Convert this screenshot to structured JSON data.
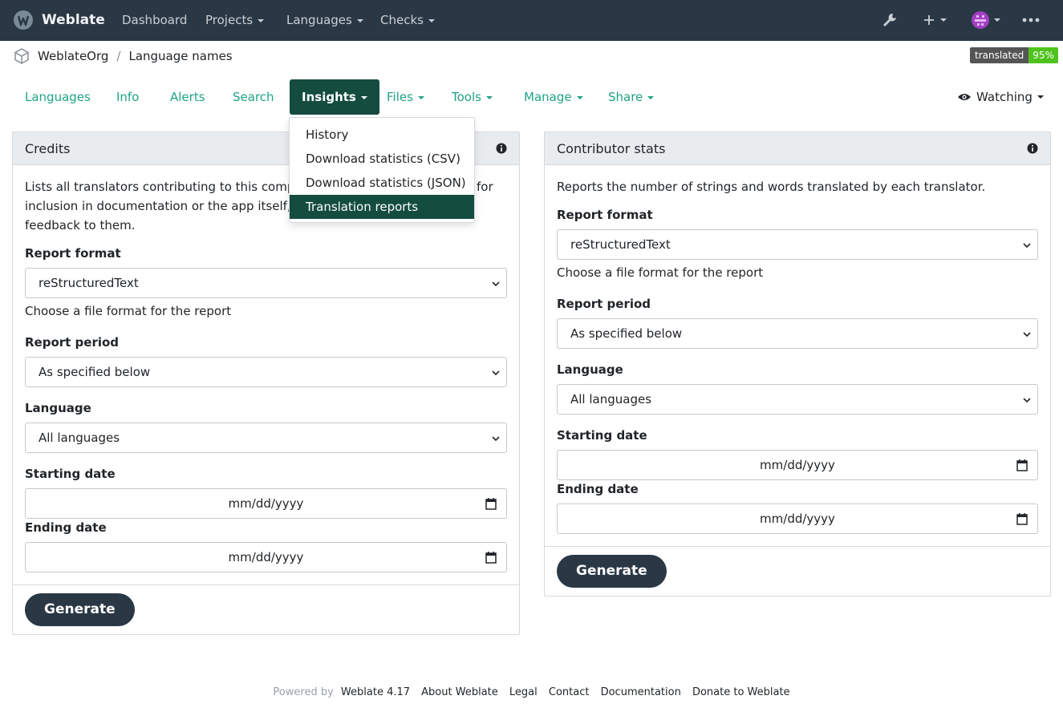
{
  "navbar": {
    "brand": "Weblate",
    "items": [
      {
        "label": "Dashboard",
        "dropdown": false
      },
      {
        "label": "Projects",
        "dropdown": true
      },
      {
        "label": "Languages",
        "dropdown": true
      },
      {
        "label": "Checks",
        "dropdown": true
      }
    ],
    "icons": [
      "wrench-icon",
      "plus-icon",
      "avatar",
      "more-icon"
    ]
  },
  "breadcrumb": {
    "project": "WeblateOrg",
    "component": "Language names"
  },
  "badge": {
    "label": "translated",
    "value": "95%"
  },
  "tabs": [
    {
      "label": "Languages"
    },
    {
      "label": "Info"
    },
    {
      "label": "Alerts"
    },
    {
      "label": "Search"
    },
    {
      "label": "Insights",
      "active": true
    },
    {
      "label": "Files"
    },
    {
      "label": "Tools"
    },
    {
      "label": "Manage"
    },
    {
      "label": "Share"
    }
  ],
  "watching": "Watching",
  "insights_menu": {
    "items": [
      "History",
      "Download statistics (CSV)",
      "Download statistics (JSON)",
      "Translation reports"
    ],
    "selected": "Translation reports"
  },
  "credits": {
    "title": "Credits",
    "description_visible": [
      "Lists all translators contributing to this compon",
      "for",
      "inclusion in documentation or the app itself, to t",
      "feedback to them."
    ],
    "format_label": "Report format",
    "format_value": "reStructuredText",
    "format_help": "Choose a file format for the report",
    "period_label": "Report period",
    "period_value": "As specified below",
    "language_label": "Language",
    "language_value": "All languages",
    "start_label": "Starting date",
    "start_placeholder": "mm/dd/yyyy",
    "end_label": "Ending date",
    "end_placeholder": "mm/dd/yyyy",
    "button": "Generate"
  },
  "contributor": {
    "title": "Contributor stats",
    "description": "Reports the number of strings and words translated by each translator.",
    "format_label": "Report format",
    "format_value": "reStructuredText",
    "format_help": "Choose a file format for the report",
    "period_label": "Report period",
    "period_value": "As specified below",
    "language_label": "Language",
    "language_value": "All languages",
    "start_label": "Starting date",
    "start_placeholder": "mm/dd/yyyy",
    "end_label": "Ending date",
    "end_placeholder": "mm/dd/yyyy",
    "button": "Generate"
  },
  "footer": {
    "powered_by": "Powered by",
    "links": [
      "Weblate 4.17",
      "About Weblate",
      "Legal",
      "Contact",
      "Documentation",
      "Donate to Weblate"
    ]
  },
  "colors": {
    "navbar_bg": "#2a3744",
    "accent": "#1fa385",
    "active_tab": "#144d3f",
    "badge_green": "#4fc21d"
  }
}
